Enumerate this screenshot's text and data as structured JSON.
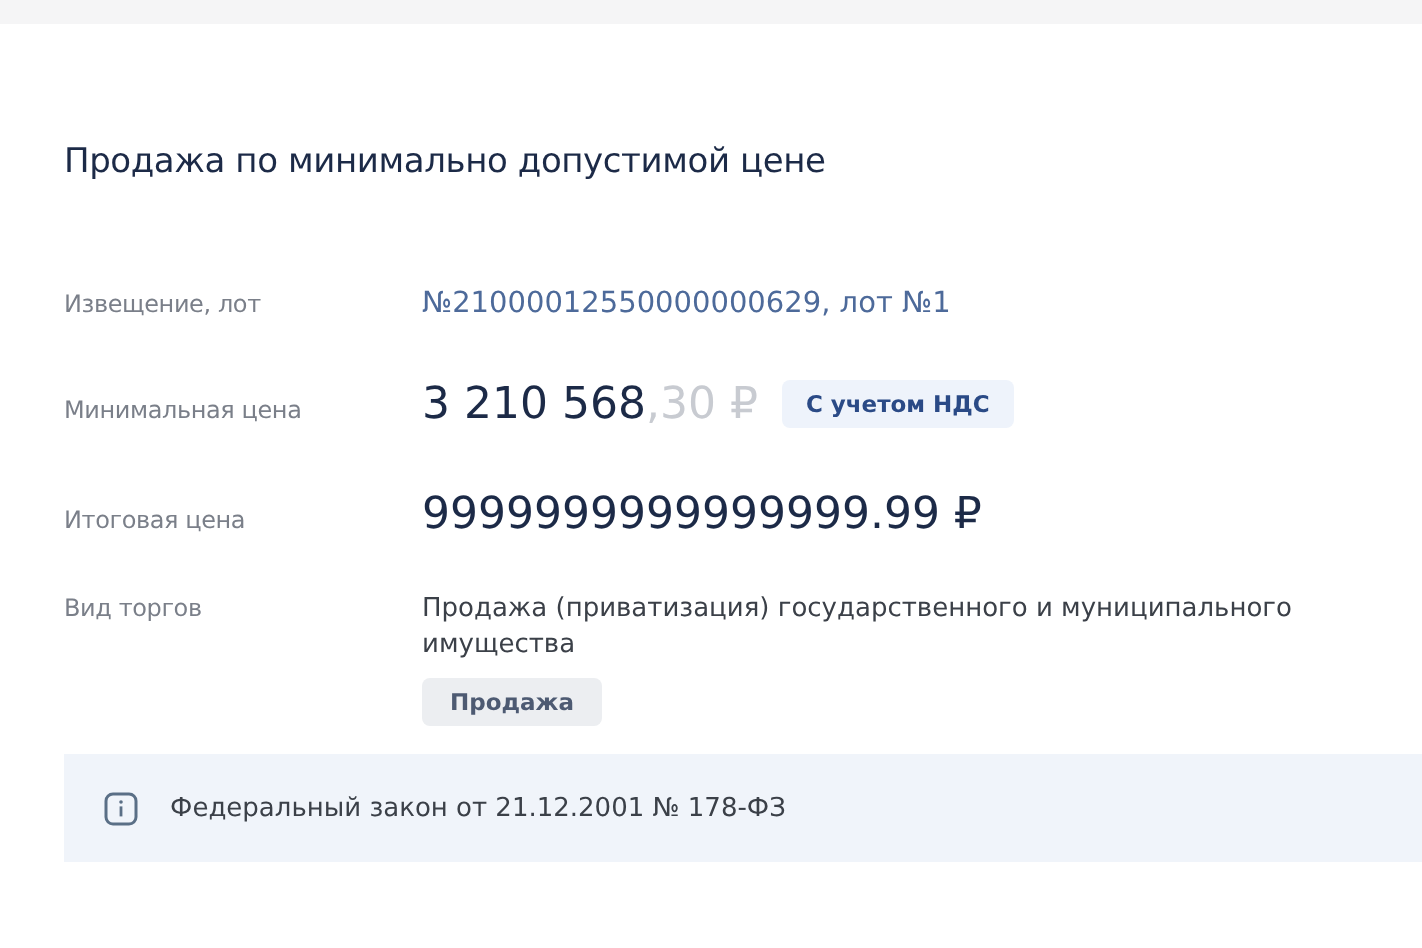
{
  "title": "Продажа по минимально допустимой цене",
  "notice": {
    "label": "Извещение, лот",
    "value": "№21000012550000000629, лот №1"
  },
  "min_price": {
    "label": "Минимальная цена",
    "amount": "3 210 568",
    "fraction": ",30 ₽",
    "badge": "С учетом НДС"
  },
  "final_price": {
    "label": "Итоговая цена",
    "value": "9999999999999999.99 ₽"
  },
  "auction_type": {
    "label": "Вид торгов",
    "value": "Продажа (приватизация) государственного и муниципального имущества",
    "tag": "Продажа"
  },
  "info": {
    "text": "Федеральный закон от 21.12.2001 № 178-ФЗ"
  }
}
